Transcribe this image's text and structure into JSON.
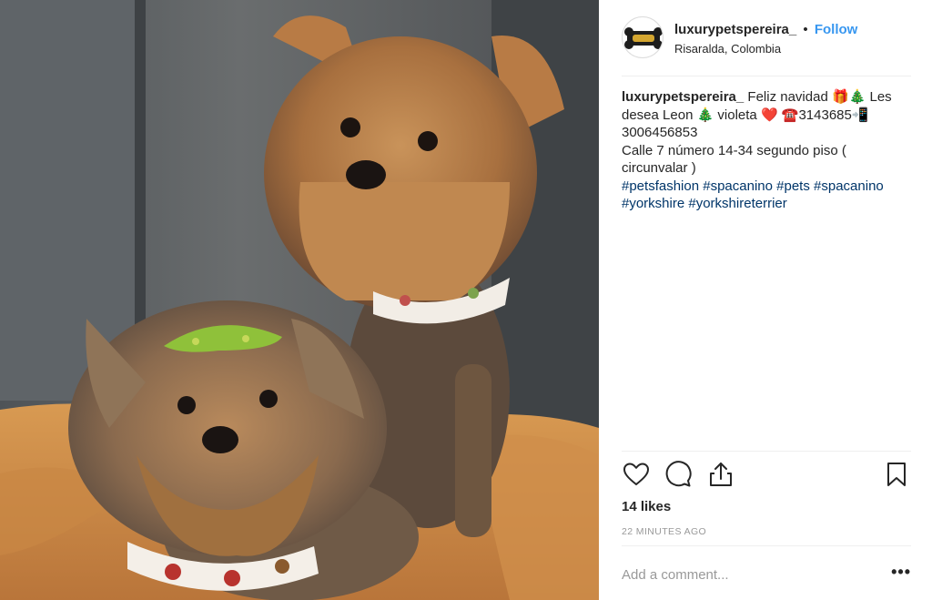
{
  "post": {
    "username": "luxurypetspereira_",
    "separator": "•",
    "follow_label": "Follow",
    "location": "Risaralda, Colombia",
    "caption": {
      "username": "luxurypetspereira_",
      "text_1": " Feliz navidad 🎁🎄 Les",
      "text_2": "desea Leon 🎄 violeta ❤️ ☎️3143685📲",
      "text_3": "3006456853",
      "text_4": "Calle 7 número 14-34 segundo piso (",
      "text_5": "circunvalar )",
      "hashtags": [
        "#petsfashion",
        "#spacanino",
        "#pets",
        "#spacanino",
        "#yorkshire",
        "#yorkshireterrier"
      ]
    },
    "likes": "14 likes",
    "time": "22 MINUTES AGO",
    "comment_placeholder": "Add a comment...",
    "more_label": "•••"
  },
  "icons": {
    "avatar": "luxury-pets-logo",
    "like": "heart-icon",
    "comment": "comment-bubble-icon",
    "share": "share-icon",
    "save": "bookmark-icon"
  },
  "colors": {
    "link_blue": "#3897f0",
    "hashtag_blue": "#003569",
    "text": "#262626",
    "muted": "#999999",
    "divider": "#efefef"
  }
}
